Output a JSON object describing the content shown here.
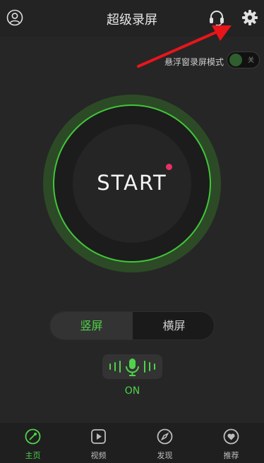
{
  "header": {
    "title": "超级录屏",
    "avatar_icon": "user-circle-icon",
    "headset_icon": "headset-icon",
    "settings_icon": "gear-icon"
  },
  "floating_mode": {
    "label": "悬浮窗录屏模式",
    "state_text": "关"
  },
  "record": {
    "label": "START"
  },
  "orientation": {
    "portrait": "竖屏",
    "landscape": "横屏",
    "selected": "竖屏"
  },
  "mic": {
    "icon": "microphone-icon",
    "status": "ON"
  },
  "nav": {
    "items": [
      {
        "label": "主页",
        "icon": "home-dial-icon",
        "active": true
      },
      {
        "label": "视频",
        "icon": "video-play-icon",
        "active": false
      },
      {
        "label": "发现",
        "icon": "compass-icon",
        "active": false
      },
      {
        "label": "推荐",
        "icon": "heart-icon",
        "active": false
      }
    ]
  },
  "colors": {
    "accent_green": "#4fd24a",
    "record_dot": "#e83068",
    "annotation_arrow": "#e8151b"
  }
}
